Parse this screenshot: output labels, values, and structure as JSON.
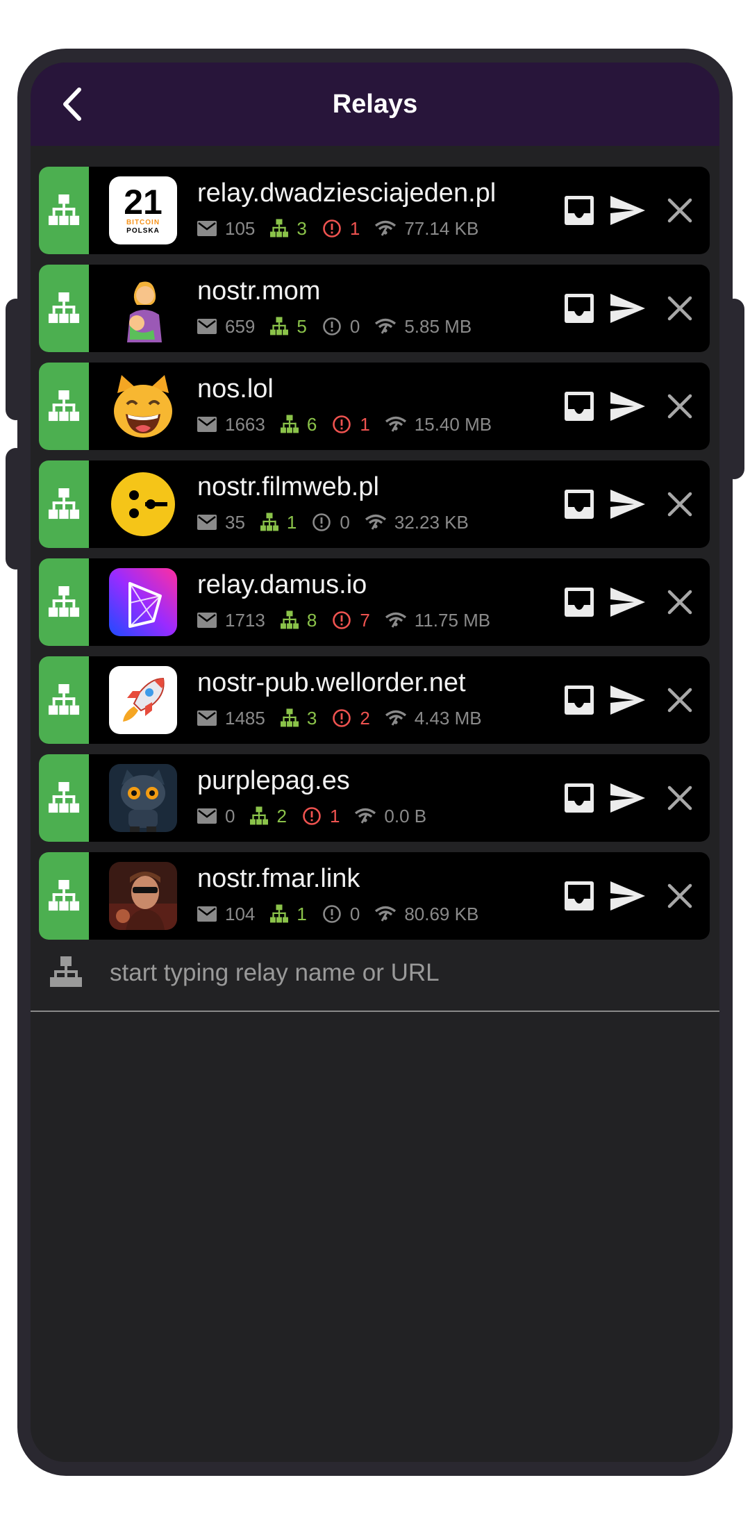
{
  "header": {
    "title": "Relays"
  },
  "relays": [
    {
      "name": "relay.dwadziesciajeden.pl",
      "messages": "105",
      "connections": "3",
      "errors": "1",
      "errors_red": true,
      "traffic": "77.14 KB",
      "avatar": "bitcoin-polska-logo"
    },
    {
      "name": "nostr.mom",
      "messages": "659",
      "connections": "5",
      "errors": "0",
      "errors_red": false,
      "traffic": "5.85 MB",
      "avatar": "mother-feeding-baby-emoji"
    },
    {
      "name": "nos.lol",
      "messages": "1663",
      "connections": "6",
      "errors": "1",
      "errors_red": true,
      "traffic": "15.40 MB",
      "avatar": "grinning-cat-emoji"
    },
    {
      "name": "nostr.filmweb.pl",
      "messages": "35",
      "connections": "1",
      "errors": "0",
      "errors_red": false,
      "traffic": "32.23 KB",
      "avatar": "filmweb-logo"
    },
    {
      "name": "relay.damus.io",
      "messages": "1713",
      "connections": "8",
      "errors": "7",
      "errors_red": true,
      "traffic": "11.75 MB",
      "avatar": "damus-logo"
    },
    {
      "name": "nostr-pub.wellorder.net",
      "messages": "1485",
      "connections": "3",
      "errors": "2",
      "errors_red": true,
      "traffic": "4.43 MB",
      "avatar": "rocket-logo"
    },
    {
      "name": "purplepag.es",
      "messages": "0",
      "connections": "2",
      "errors": "1",
      "errors_red": true,
      "traffic": "0.0 B",
      "avatar": "robot-cat-image"
    },
    {
      "name": "nostr.fmar.link",
      "messages": "104",
      "connections": "1",
      "errors": "0",
      "errors_red": false,
      "traffic": "80.69 KB",
      "avatar": "person-photo"
    }
  ],
  "add_relay": {
    "placeholder": "start typing relay name or URL"
  },
  "colors": {
    "accent_green": "#4caf50",
    "header_bg": "#28153a",
    "error_red": "#ef5350",
    "ok_green": "#8bc34a"
  }
}
